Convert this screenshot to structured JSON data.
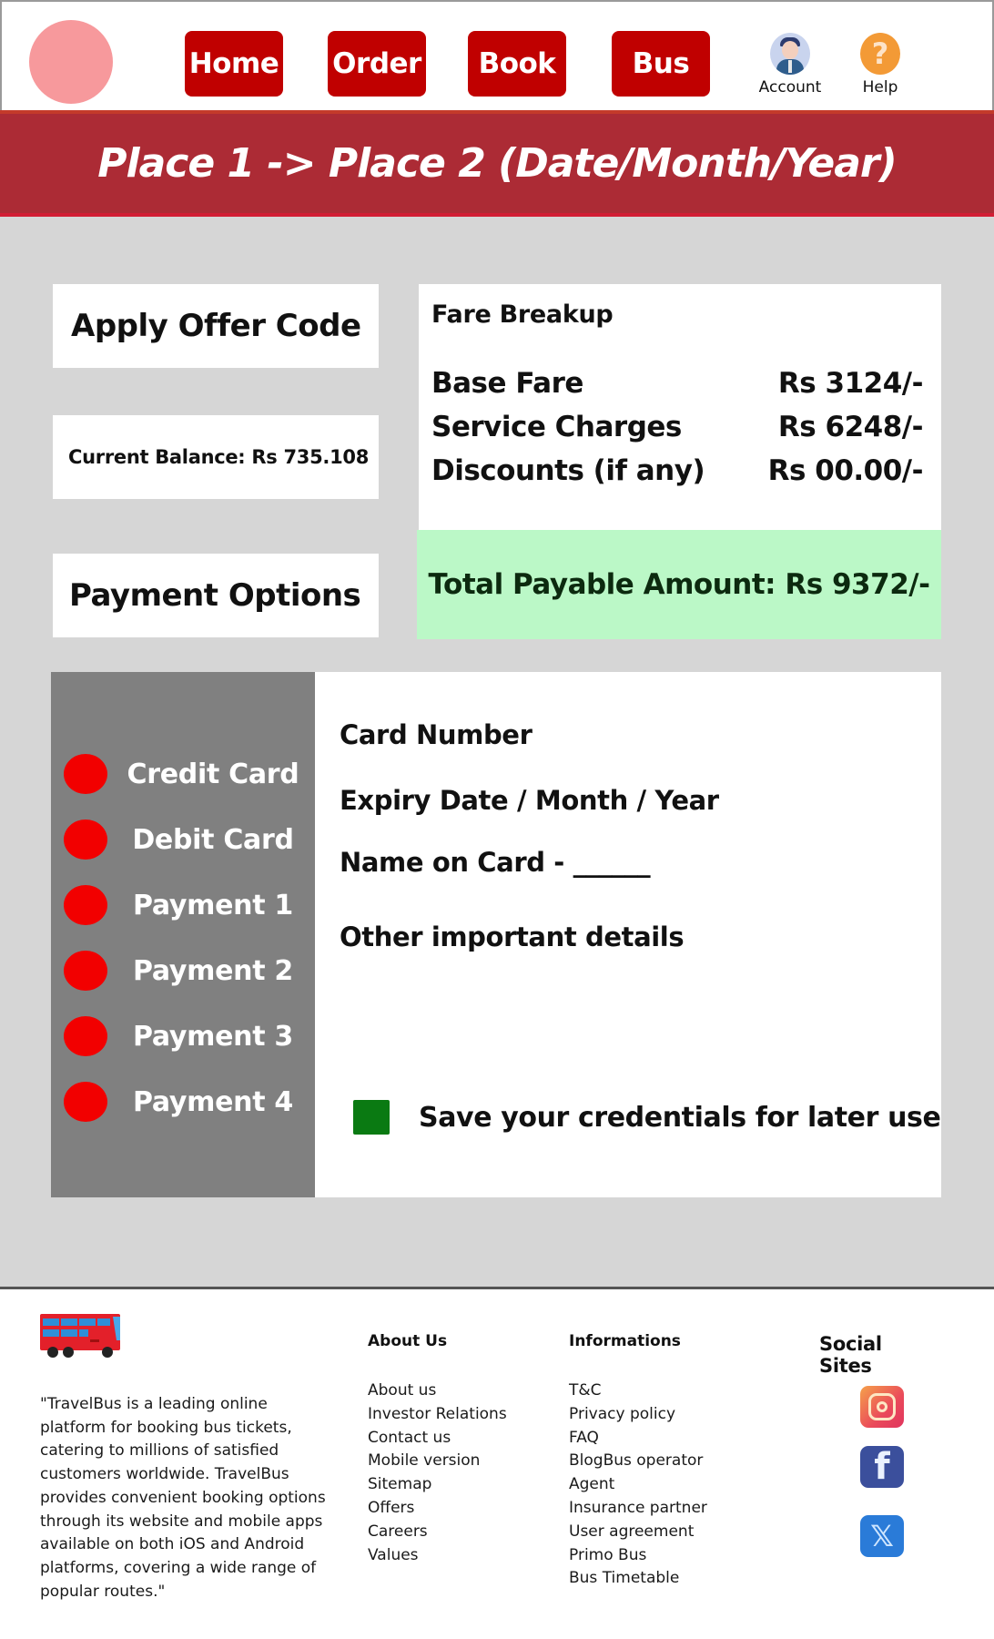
{
  "header": {
    "nav": [
      {
        "label": "Home"
      },
      {
        "label": "Order"
      },
      {
        "label": "Book"
      },
      {
        "label": "Bus"
      }
    ],
    "account_label": "Account",
    "help_label": "Help",
    "help_glyph": "?"
  },
  "banner": {
    "title": "Place 1 -> Place 2  (Date/Month/Year)"
  },
  "left_panel": {
    "offer_label": "Apply Offer Code",
    "balance_label": "Current Balance: Rs 735.108",
    "payment_options_label": "Payment Options"
  },
  "fare": {
    "title": "Fare Breakup",
    "rows": [
      {
        "label": "Base Fare",
        "value": "Rs 3124/-"
      },
      {
        "label": "Service Charges",
        "value": "Rs 6248/-"
      },
      {
        "label": "Discounts (if any)",
        "value": "Rs 00.00/-"
      }
    ],
    "total_label": "Total Payable Amount: Rs 9372/-"
  },
  "payment": {
    "methods": [
      {
        "label": "Credit Card"
      },
      {
        "label": "Debit Card"
      },
      {
        "label": "Payment 1"
      },
      {
        "label": "Payment 2"
      },
      {
        "label": "Payment 3"
      },
      {
        "label": "Payment 4"
      }
    ],
    "form": {
      "card_number": "Card Number",
      "expiry": "Expiry Date / Month / Year",
      "name_on_card": "Name on Card - ______",
      "other": "Other important details",
      "save_label": "Save your credentials for later use",
      "save_checked": true
    }
  },
  "footer": {
    "about_text": "\"TravelBus is a leading online platform for booking bus tickets, catering to millions of satisfied customers worldwide. TravelBus provides convenient booking options through its website and mobile apps available on both iOS and Android platforms, covering a wide range of popular routes.\"",
    "about_us": {
      "heading": "About Us",
      "links": [
        "About us",
        "Investor Relations",
        "Contact us",
        "Mobile version",
        "Sitemap",
        "Offers",
        "Careers",
        "Values"
      ]
    },
    "informations": {
      "heading": "Informations",
      "links": [
        "T&C",
        "Privacy policy",
        "FAQ",
        "BlogBus operator",
        "Agent",
        "Insurance partner",
        "User agreement",
        "Primo Bus",
        "Bus Timetable"
      ]
    },
    "social": {
      "heading": "Social Sites",
      "icons": [
        "instagram-icon",
        "facebook-icon",
        "x-icon"
      ],
      "facebook_glyph": "f",
      "x_glyph": "𝕏"
    }
  },
  "colors": {
    "brand_red": "#c00000",
    "banner_red": "#ac2b35",
    "total_green": "#bbf8c7",
    "radio_red": "#f20000",
    "checkbox_green": "#0a7a12",
    "side_gray": "#808080",
    "page_gray": "#d6d6d6"
  }
}
